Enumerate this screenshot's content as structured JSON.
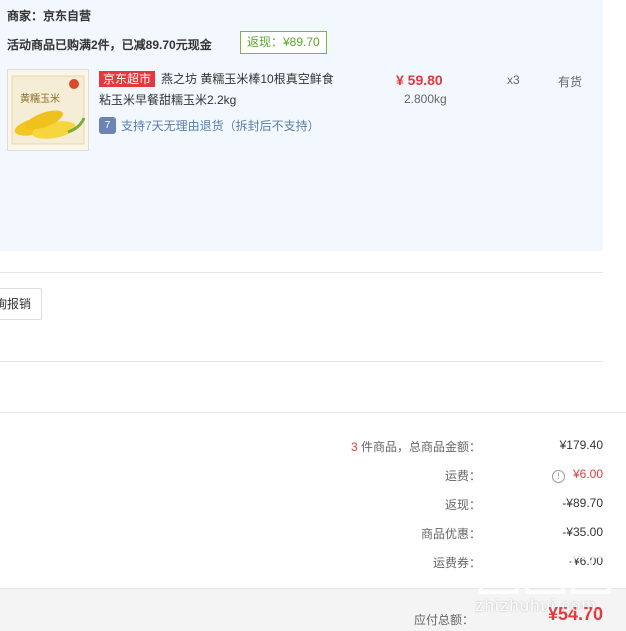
{
  "shop": {
    "seller": "商家：京东自营",
    "promo": "活动商品已购满2件，已减89.70元现金",
    "rebate_badge": "返现：¥89.70"
  },
  "item": {
    "thumb_text": "黄糯玉米",
    "tag": "京东超市",
    "title_line1": "燕之坊 黄糯玉米棒10根真空鲜食",
    "title_line2": "粘玉米早餐甜糯玉米2.2kg",
    "return_icon": "7",
    "return_text": "支持7天无理由退货（拆封后不支持）",
    "price": "¥ 59.80",
    "weight": "2.800kg",
    "qty": "x3",
    "stock": "有货"
  },
  "invoice": {
    "button_label": "询报销"
  },
  "summary": {
    "count": "3",
    "count_label": " 件商品，总商品金额：",
    "total_goods": "¥179.40",
    "freight_label": "运费：",
    "freight": "¥6.00",
    "rebate_label": "返现：",
    "rebate": "-¥89.70",
    "discount_label": "商品优惠：",
    "discount": "-¥35.00",
    "coupon_label": "运费券：",
    "coupon": "-¥6.00"
  },
  "total": {
    "label": "应付总额：",
    "value": "¥54.70"
  },
  "watermark": {
    "text": "zhizhuhui.com"
  },
  "colors": {
    "accent_red": "#e4393c",
    "rebate_green": "#58a629",
    "panel_bg": "#f3f8fe"
  }
}
